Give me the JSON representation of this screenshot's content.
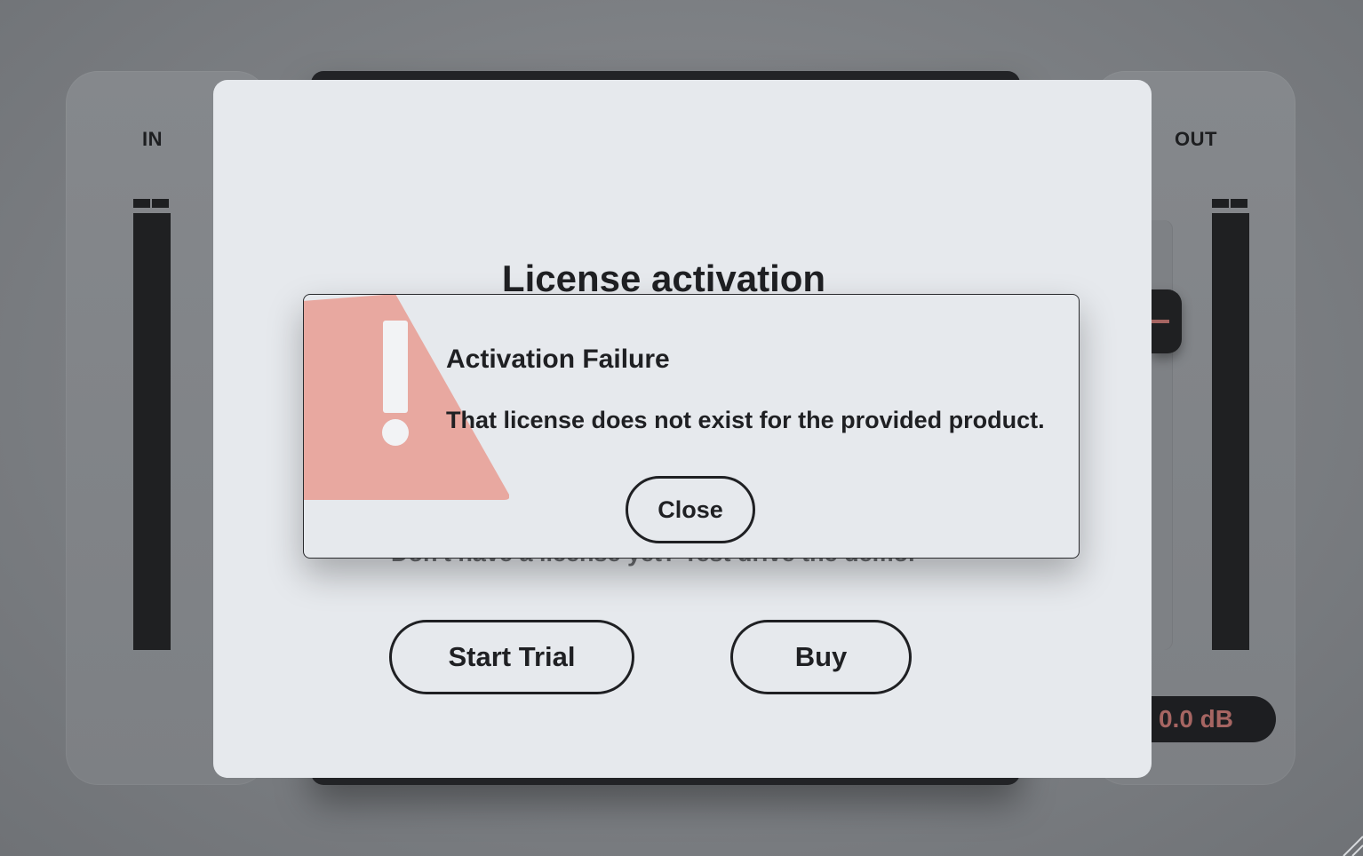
{
  "plugin": {
    "input_label": "IN",
    "output_label": "OUT",
    "output_gain": "0.0 dB"
  },
  "license_modal": {
    "title": "License activation",
    "trial_prompt": "Don't have a license yet? Test drive the demo.",
    "start_trial_label": "Start Trial",
    "buy_label": "Buy"
  },
  "error_dialog": {
    "title": "Activation Failure",
    "message": "That license does not exist for the provided product.",
    "close_label": "Close",
    "icon": "warning-icon"
  },
  "colors": {
    "warning": "#e8a8a0",
    "accent": "#a66562",
    "dialog_bg": "#e6e9ed",
    "text": "#1f2023"
  }
}
